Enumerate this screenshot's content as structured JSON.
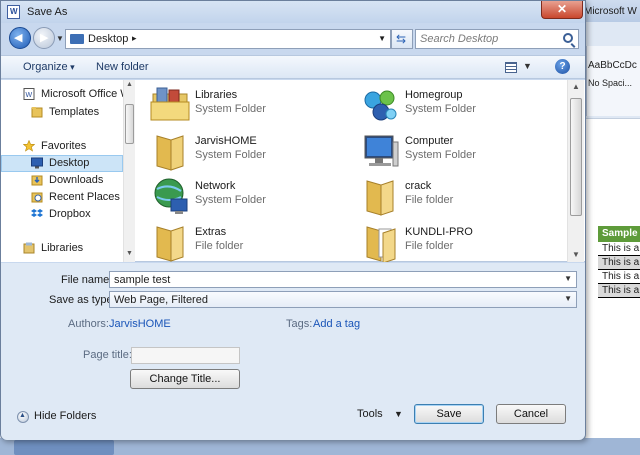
{
  "background": {
    "word_title": "Microsoft W",
    "style_gallery_sample": "AaBbCcDc",
    "style_gallery_name": "No Spaci...",
    "table_header": "Sample",
    "table_rows": [
      "This is a",
      "This is a",
      "This is a",
      "This is a"
    ],
    "table_header_color": "#5e9b3a"
  },
  "dialog": {
    "title": "Save As",
    "close_icon": "close-icon",
    "address": {
      "location": "Desktop",
      "separator": "▸"
    },
    "search": {
      "placeholder": "Search Desktop"
    },
    "toolbar": {
      "organize": "Organize",
      "new_folder": "New folder",
      "help": "?"
    },
    "nav_items": [
      {
        "label": "Microsoft Office W",
        "icon": "word-document-icon"
      },
      {
        "label": "Templates",
        "icon": "folder-icon"
      },
      {
        "label": "Favorites",
        "icon": "star-icon"
      },
      {
        "label": "Desktop",
        "icon": "desktop-icon",
        "selected": true
      },
      {
        "label": "Downloads",
        "icon": "downloads-folder-icon"
      },
      {
        "label": "Recent Places",
        "icon": "recent-places-icon"
      },
      {
        "label": "Dropbox",
        "icon": "dropbox-icon"
      },
      {
        "label": "Libraries",
        "icon": "libraries-icon"
      }
    ],
    "files": [
      {
        "name": "Libraries",
        "type": "System Folder",
        "icon": "libraries-icon"
      },
      {
        "name": "Homegroup",
        "type": "System Folder",
        "icon": "homegroup-icon"
      },
      {
        "name": "JarvisHOME",
        "type": "System Folder",
        "icon": "user-folder-icon"
      },
      {
        "name": "Computer",
        "type": "System Folder",
        "icon": "computer-icon"
      },
      {
        "name": "Network",
        "type": "System Folder",
        "icon": "network-icon"
      },
      {
        "name": "crack",
        "type": "File folder",
        "icon": "folder-icon"
      },
      {
        "name": "Extras",
        "type": "File folder",
        "icon": "folder-icon"
      },
      {
        "name": "KUNDLI-PRO",
        "type": "File folder",
        "icon": "folder-icon"
      }
    ],
    "form": {
      "file_name_label": "File name:",
      "file_name_value": "sample test",
      "save_type_label": "Save as type:",
      "save_type_value": "Web Page, Filtered",
      "authors_label": "Authors:",
      "authors_value": "JarvisHOME",
      "tags_label": "Tags:",
      "tags_value": "Add a tag",
      "page_title_label": "Page title:",
      "page_title_value": "",
      "change_title_button": "Change Title...",
      "hide_folders": "Hide Folders",
      "tools": "Tools",
      "save_button": "Save",
      "cancel_button": "Cancel"
    }
  }
}
